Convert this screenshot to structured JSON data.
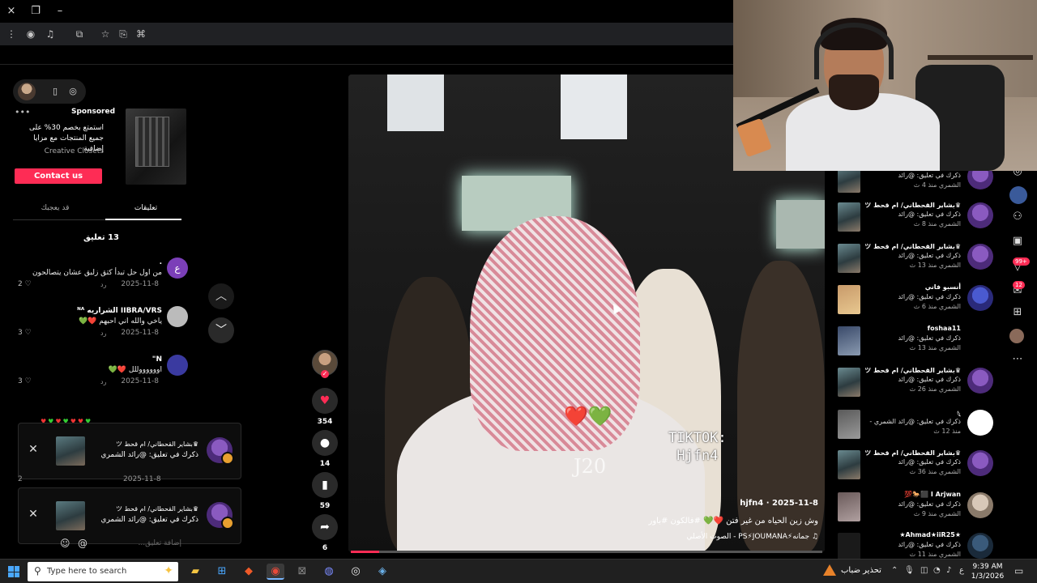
{
  "browser": {
    "close_icon": "×",
    "restore_icon": "❐",
    "minimize_icon": "–"
  },
  "ad": {
    "label": "Sponsored",
    "text": "استمتع بخصم 30% على جميع المنتجات مع مزايا إضافية",
    "brand": "Creative Closets",
    "cta": "Contact us"
  },
  "tabs": {
    "comments": "تعليقات",
    "you_may_like": "قد يعجبك"
  },
  "comment_count": "13 تعليق",
  "comments": [
    {
      "name": ".",
      "text": "من اول حل تبدأ كتق زلبق عشان يتصالحون",
      "date": "2025-11-8",
      "reply": "رد",
      "likes": "2",
      "avatar_color": "#7b3fb8"
    },
    {
      "name": "IIBRA/VRS الشراريه ᴺᴬ",
      "text": "ياخي والله اني احبهم ❤️💚",
      "date": "2025-11-8",
      "reply": "رد",
      "likes": "3",
      "avatar_color": "#bbbbbb"
    },
    {
      "name": "N\"",
      "text": "اووووووللل ❤️💚",
      "date": "2025-11-8",
      "reply": "رد",
      "likes": "3",
      "avatar_color": "#3a3aa0"
    }
  ],
  "notifications": [
    {
      "title": "♛بشاير القحطاني/ ام قحط ツ",
      "body": "ذكرك في تعليق: @رائد الشمري"
    },
    {
      "title": "♛بشاير القحطاني/ ام قحط ツ",
      "body": "ذكرك في تعليق: @رائد الشمري"
    }
  ],
  "notif_partial_date": "2025-11-8",
  "notif_partial_likes": "2",
  "comment_input_placeholder": "إضافة تعليق...",
  "video": {
    "author": "hjfn4",
    "date": "2025-11-8",
    "separator": "·",
    "caption": "وش زين الحياه من غير فتن ❤️💚 #فالكون #باور",
    "music": "♫ جمانه⚡PS⚡JOUMANA - الصوت الأصلي",
    "watermark_line1": "TIKTOK:",
    "watermark_line2": "Hjfn4",
    "overlay_text": "J20",
    "hearts": "❤️💚",
    "progress": 0.06
  },
  "actions": {
    "likes": "354",
    "comments": "14",
    "saves": "59",
    "shares": "6"
  },
  "inbox": [
    {
      "name": "",
      "desc": "ذكرك في تعليق: @رائد",
      "time": "الشمري منذ 4 ث",
      "avatar": "purple"
    },
    {
      "name": "♛بشاير القحطاني/ ام قحط ツ",
      "desc": "ذكرك في تعليق: @رائد",
      "time": "الشمري منذ 8 ث",
      "avatar": "purple"
    },
    {
      "name": "♛بشاير القحطاني/ ام قحط ツ",
      "desc": "ذكرك في تعليق: @رائد",
      "time": "الشمري منذ 13 ث",
      "avatar": "purple"
    },
    {
      "name": "أنسبو فاني",
      "desc": "ذكرك في تعليق: @رائد",
      "time": "الشمري منذ 6 ث",
      "avatar": "blue"
    },
    {
      "name": "foshaa11",
      "desc": "ذكرك في تعليق: @رائد",
      "time": "الشمري منذ 13 ث",
      "avatar": "none"
    },
    {
      "name": "♛بشاير القحطاني/ ام قحط ツ",
      "desc": "ذكرك في تعليق: @رائد",
      "time": "الشمري منذ 26 ث",
      "avatar": "purple"
    },
    {
      "name": "𓆩",
      "desc": "ذكرك في تعليق: @رائد الشمري -",
      "time": "منذ 12 ث",
      "avatar": "white"
    },
    {
      "name": "♛بشاير القحطاني/ ام قحط ツ",
      "desc": "ذكرك في تعليق: @رائد",
      "time": "الشمري منذ 36 ث",
      "avatar": "purple"
    },
    {
      "name": "I Arjwan ⬛🐎💯",
      "desc": "ذكرك في تعليق: @رائد",
      "time": "الشمري منذ 9 ث",
      "avatar": "photo"
    },
    {
      "name": "★Ahmad★iiR25★",
      "desc": "ذكرك في تعليق: @رائد",
      "time": "الشمري منذ 11 ث",
      "avatar": "dark"
    }
  ],
  "side_badges": {
    "activity": "99+",
    "messages": "12"
  },
  "taskbar": {
    "search_placeholder": "Type here to search",
    "weather": "تحذير ضباب",
    "lang": "ع",
    "time": "9:39 AM",
    "date": "1/3/2026"
  },
  "colors": {
    "accent": "#fe2c55",
    "background": "#000000",
    "taskbar": "#202020"
  }
}
